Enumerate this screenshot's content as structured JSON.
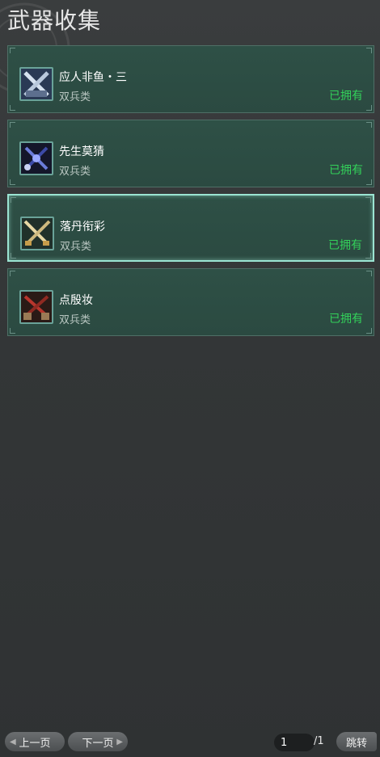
{
  "title": "武器收集",
  "items": [
    {
      "name": "应人非鱼・三",
      "category": "双兵类",
      "status": "已拥有",
      "icon": "crossed-blades-silver-icon",
      "selected": false
    },
    {
      "name": "先生莫猜",
      "category": "双兵类",
      "status": "已拥有",
      "icon": "crossed-blades-dark-blue-icon",
      "selected": false
    },
    {
      "name": "落丹衔彩",
      "category": "双兵类",
      "status": "已拥有",
      "icon": "crossed-blades-gold-icon",
      "selected": true
    },
    {
      "name": "点殷妆",
      "category": "双兵类",
      "status": "已拥有",
      "icon": "crossed-blades-red-icon",
      "selected": false
    }
  ],
  "pagination": {
    "prev_label": "上一页",
    "next_label": "下一页",
    "current_page": "1",
    "total": "/1",
    "jump_label": "跳转"
  },
  "colors": {
    "owned_status": "#33d15a",
    "card_bg": "#2e5046",
    "selected_border": "#9be4d2"
  }
}
